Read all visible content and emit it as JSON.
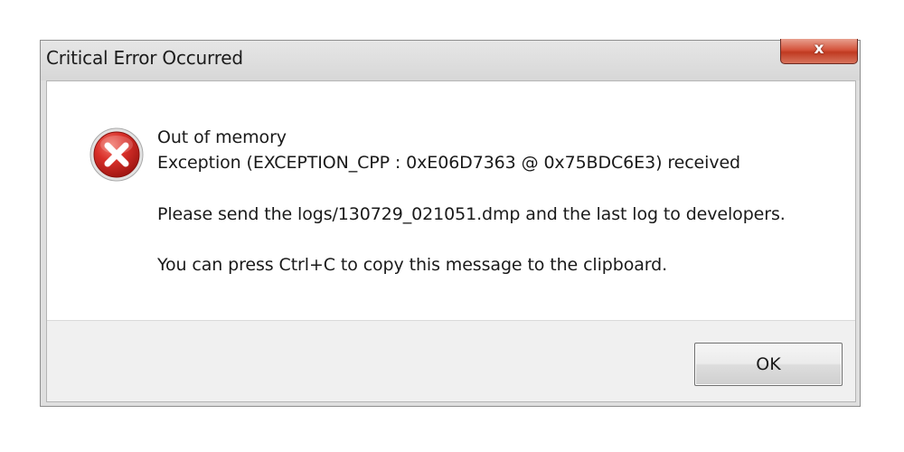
{
  "window": {
    "title": "Critical Error Occurred",
    "close_label": "x"
  },
  "message": {
    "icon": "error-icon",
    "line1": "Out of memory",
    "line2": "Exception (EXCEPTION_CPP : 0xE06D7363 @ 0x75BDC6E3) received",
    "line3": "Please send the logs/130729_021051.dmp and the last log to developers.",
    "line4": "You can press Ctrl+C to copy this message to the clipboard."
  },
  "buttons": {
    "ok_label": "OK"
  },
  "colors": {
    "error_red": "#c8211c",
    "close_button_red": "#c03a21",
    "dialog_background": "#f0f0f0"
  }
}
